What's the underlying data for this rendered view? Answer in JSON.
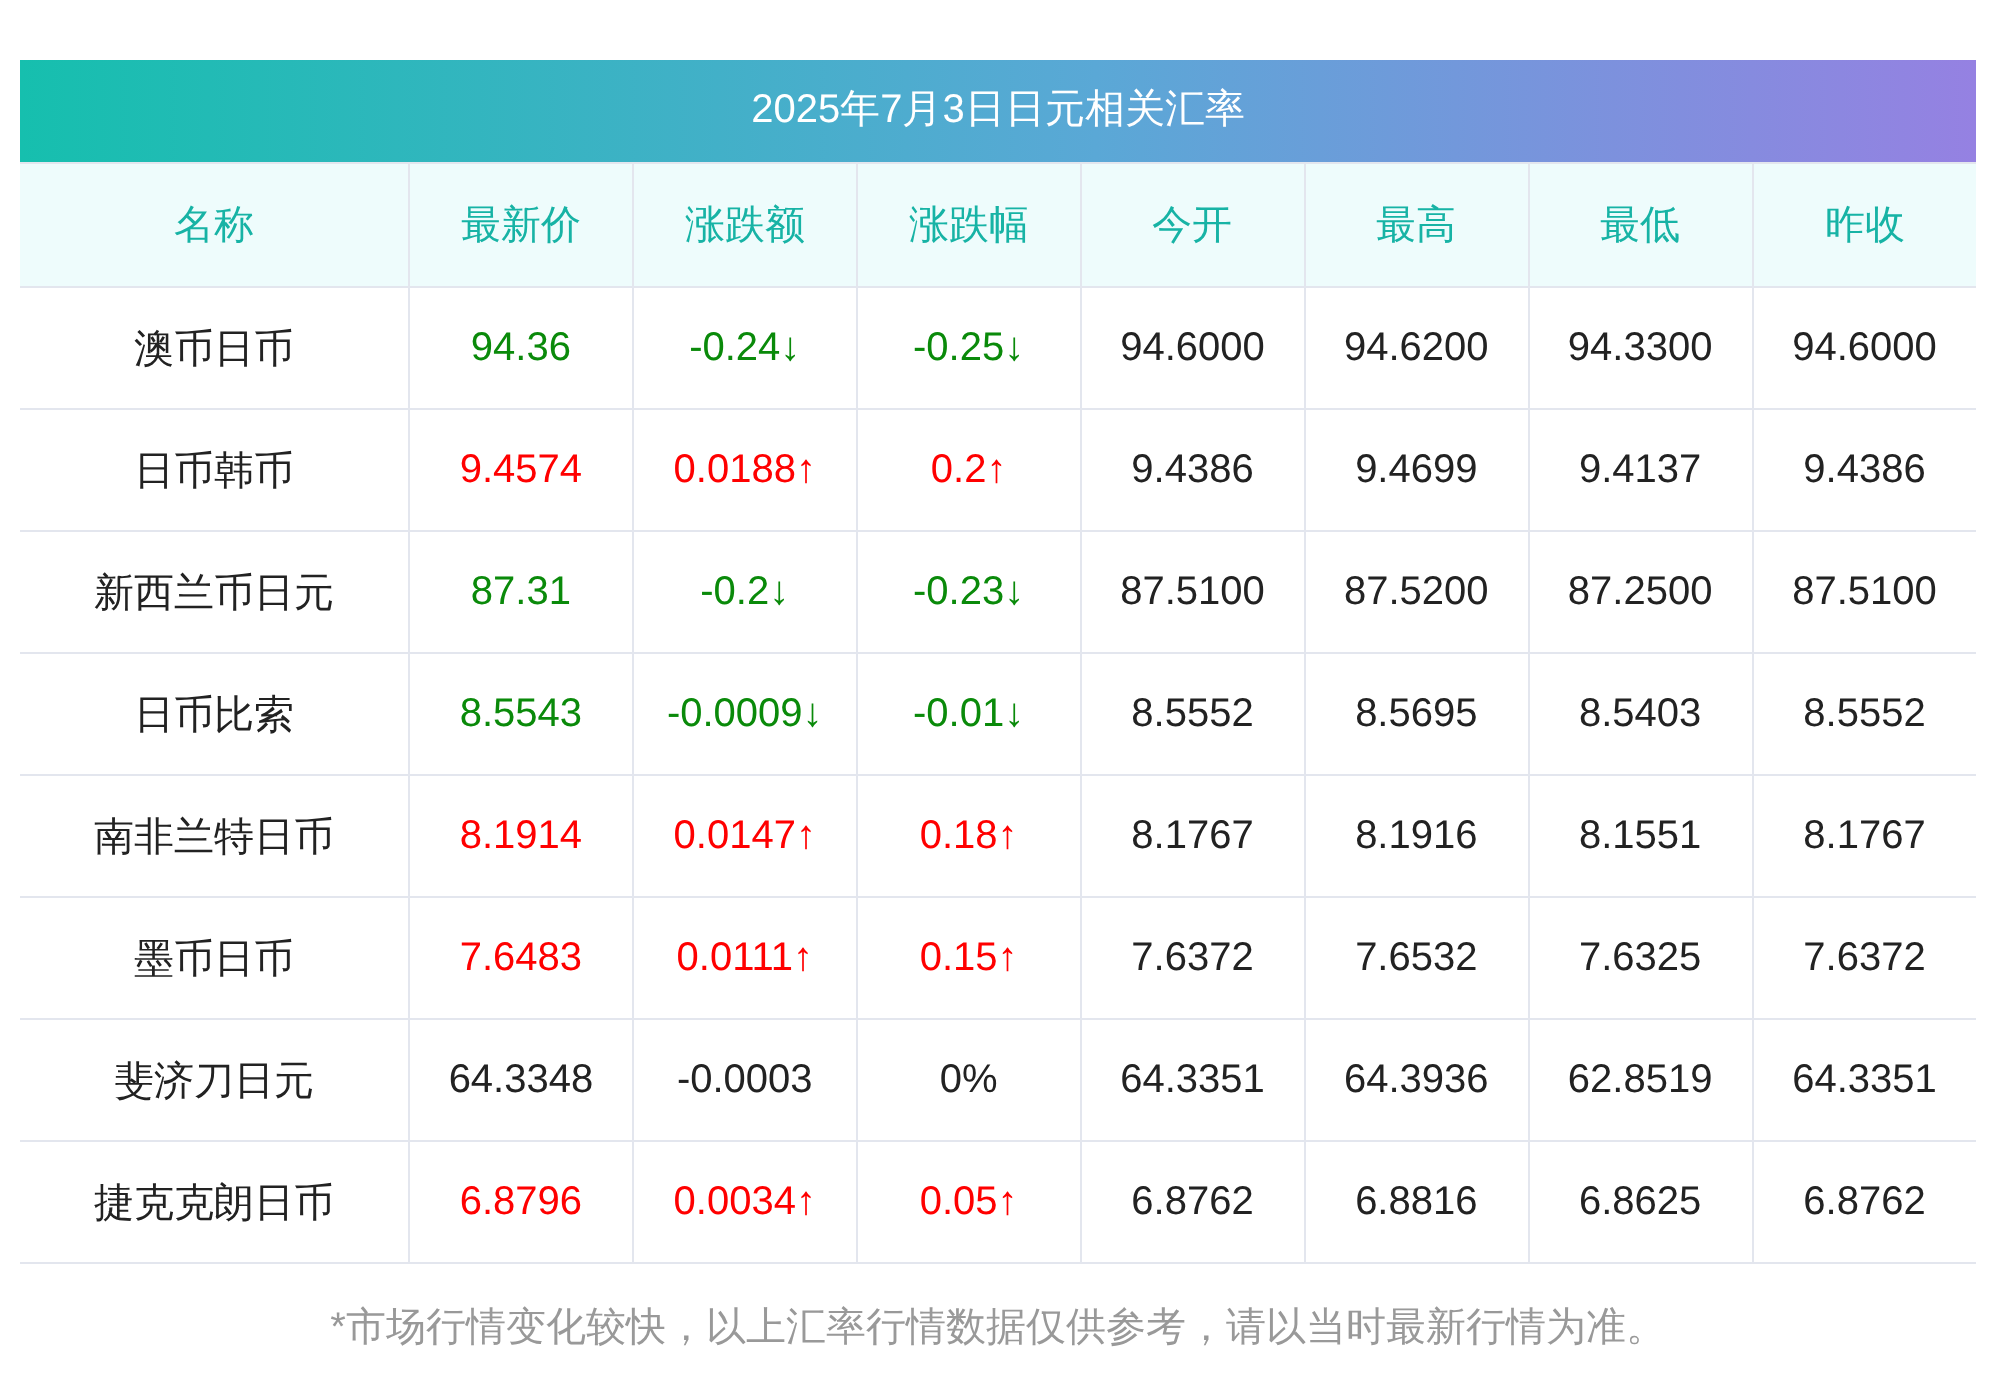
{
  "title": "2025年7月3日日元相关汇率",
  "columns": [
    "名称",
    "最新价",
    "涨跌额",
    "涨跌幅",
    "今开",
    "最高",
    "最低",
    "昨收"
  ],
  "rows": [
    {
      "color": "#0a8a0a",
      "cells": [
        "澳币日币",
        "94.36",
        "-0.24↓",
        "-0.25↓",
        "94.6000",
        "94.6200",
        "94.3300",
        "94.6000"
      ]
    },
    {
      "color": "#ff0000",
      "cells": [
        "日币韩币",
        "9.4574",
        "0.0188↑",
        "0.2↑",
        "9.4386",
        "9.4699",
        "9.4137",
        "9.4386"
      ]
    },
    {
      "color": "#0a8a0a",
      "cells": [
        "新西兰币日元",
        "87.31",
        "-0.2↓",
        "-0.23↓",
        "87.5100",
        "87.5200",
        "87.2500",
        "87.5100"
      ]
    },
    {
      "color": "#0a8a0a",
      "cells": [
        "日币比索",
        "8.5543",
        "-0.0009↓",
        "-0.01↓",
        "8.5552",
        "8.5695",
        "8.5403",
        "8.5552"
      ]
    },
    {
      "color": "#ff0000",
      "cells": [
        "南非兰特日币",
        "8.1914",
        "0.0147↑",
        "0.18↑",
        "8.1767",
        "8.1916",
        "8.1551",
        "8.1767"
      ]
    },
    {
      "color": "#ff0000",
      "cells": [
        "墨币日币",
        "7.6483",
        "0.0111↑",
        "0.15↑",
        "7.6372",
        "7.6532",
        "7.6325",
        "7.6372"
      ]
    },
    {
      "color": "#222222",
      "cells": [
        "斐济刀日元",
        "64.3348",
        "-0.0003",
        "0%",
        "64.3351",
        "64.3936",
        "62.8519",
        "64.3351"
      ]
    },
    {
      "color": "#ff0000",
      "cells": [
        "捷克克朗日币",
        "6.8796",
        "0.0034↑",
        "0.05↑",
        "6.8762",
        "6.8816",
        "6.8625",
        "6.8762"
      ]
    }
  ],
  "note": "*市场行情变化较快，以上汇率行情数据仅供参考，请以当时最新行情为准。"
}
